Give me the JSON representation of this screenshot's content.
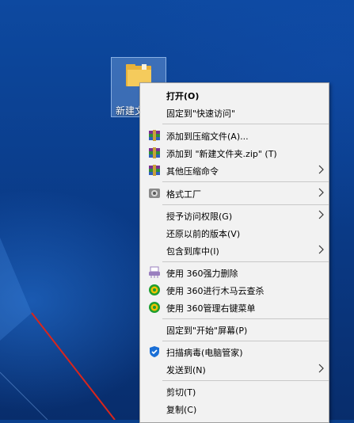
{
  "desktop": {
    "folder_label": "新建文"
  },
  "menu": {
    "open": "打开(O)",
    "pin_quick": "固定到\"快速访问\"",
    "add_archive": "添加到压缩文件(A)...",
    "add_zip": "添加到 \"新建文件夹.zip\" (T)",
    "other_compress": "其他压缩命令",
    "format_factory": "格式工厂",
    "grant_access": "授予访问权限(G)",
    "restore_prev": "还原以前的版本(V)",
    "include_library": "包含到库中(I)",
    "force_delete": "使用 360强力删除",
    "trojan_scan": "使用 360进行木马云查杀",
    "manage_menu": "使用 360管理右键菜单",
    "pin_start": "固定到\"开始\"屏幕(P)",
    "virus_scan": "扫描病毒(电脑管家)",
    "send_to": "发送到(N)",
    "cut": "剪切(T)",
    "copy": "复制(C)"
  },
  "colors": {
    "accent_red": "#e0201c",
    "menu_bg": "#f2f2f2"
  }
}
